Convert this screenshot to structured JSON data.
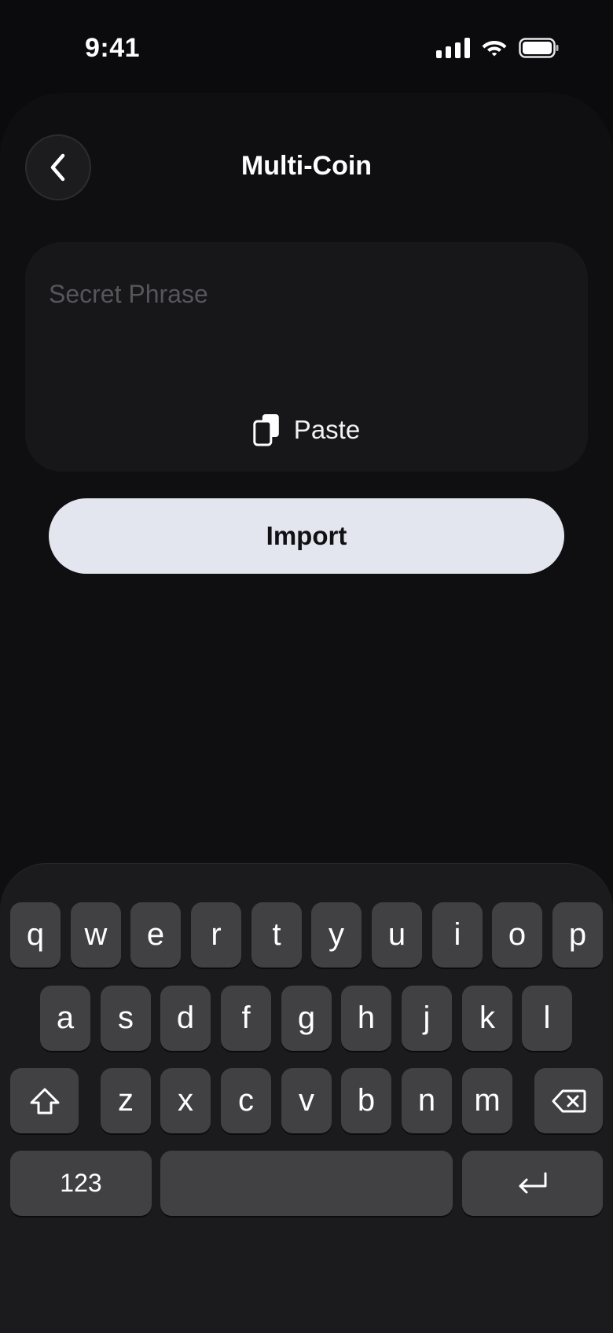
{
  "status_bar": {
    "time": "9:41",
    "icons": [
      "cellular-signal-icon",
      "wifi-icon",
      "battery-icon"
    ]
  },
  "header": {
    "title": "Multi-Coin",
    "back_icon": "chevron-left-icon"
  },
  "phrase_input": {
    "placeholder": "Secret Phrase",
    "paste_label": "Paste",
    "paste_icon": "clipboard-icon"
  },
  "import_button": {
    "label": "Import"
  },
  "keyboard": {
    "row1": [
      "q",
      "w",
      "e",
      "r",
      "t",
      "y",
      "u",
      "i",
      "o",
      "p"
    ],
    "row2": [
      "a",
      "s",
      "d",
      "f",
      "g",
      "h",
      "j",
      "k",
      "l"
    ],
    "row3": [
      "z",
      "x",
      "c",
      "v",
      "b",
      "n",
      "m"
    ],
    "shift_icon": "shift-icon",
    "delete_icon": "delete-icon",
    "numbers_label": "123",
    "return_icon": "return-icon"
  },
  "colors": {
    "background": "#0b0b0d",
    "input_background": "#17171a",
    "button_background": "#e3e6ee",
    "key_background": "#414144"
  }
}
